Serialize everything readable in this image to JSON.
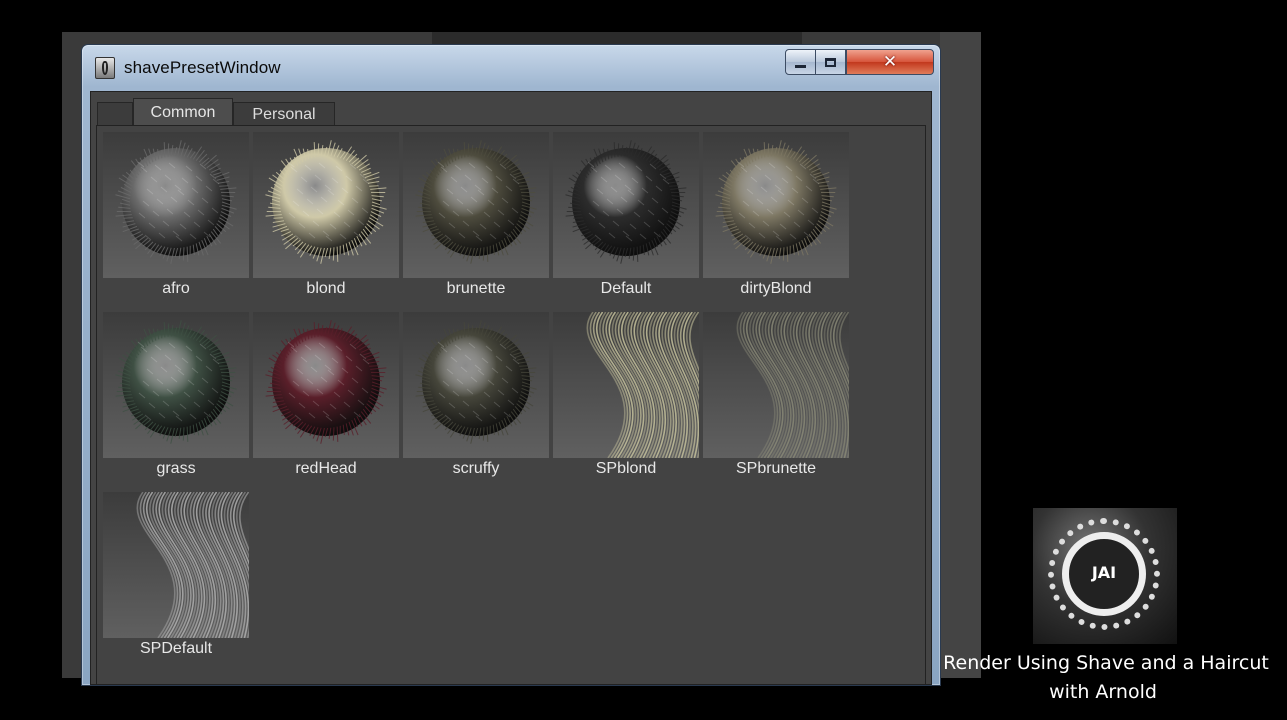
{
  "window": {
    "title": "shavePresetWindow",
    "tabs": [
      {
        "label": "Common",
        "selected": true
      },
      {
        "label": "Personal",
        "selected": false
      }
    ]
  },
  "presets": [
    {
      "name": "afro",
      "style": "ball",
      "color": "#6a6a6a"
    },
    {
      "name": "blond",
      "style": "ball",
      "color": "#cfc9a8"
    },
    {
      "name": "brunette",
      "style": "ball",
      "color": "#4e4c3e"
    },
    {
      "name": "Default",
      "style": "ball",
      "color": "#2c2c2c"
    },
    {
      "name": "dirtyBlond",
      "style": "ball",
      "color": "#7d7763"
    },
    {
      "name": "grass",
      "style": "ball",
      "color": "#3f5044"
    },
    {
      "name": "redHead",
      "style": "ball",
      "color": "#5a1f2a"
    },
    {
      "name": "scruffy",
      "style": "ball",
      "color": "#46463b"
    },
    {
      "name": "SPblond",
      "style": "strands",
      "color": "#c9c59f"
    },
    {
      "name": "SPbrunette",
      "style": "strands",
      "color": "#8a8a77"
    },
    {
      "name": "SPDefault",
      "style": "strands",
      "color": "#b3b3b3"
    }
  ],
  "branding": {
    "logo_text": "JAI",
    "caption_line1": "Render Using Shave and a Haircut",
    "caption_line2": "with Arnold"
  }
}
